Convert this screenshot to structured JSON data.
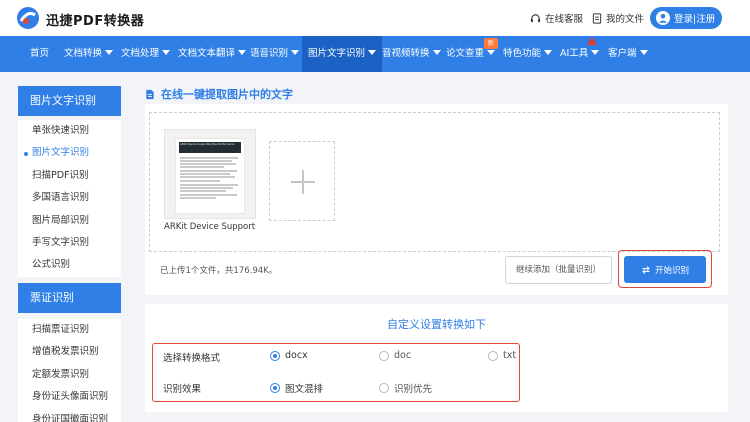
{
  "header": {
    "brand": "迅捷PDF转换器",
    "service": "在线客服",
    "files": "我的文件",
    "login": "登录|注册"
  },
  "nav": {
    "items": [
      {
        "label": "首页"
      },
      {
        "label": "文档转换"
      },
      {
        "label": "文档处理"
      },
      {
        "label": "文档文本翻译"
      },
      {
        "label": "语音识别"
      },
      {
        "label": "图片文字识别"
      },
      {
        "label": "音视频转换"
      },
      {
        "label": "论文查重"
      },
      {
        "label": "特色功能"
      },
      {
        "label": "AI工具"
      },
      {
        "label": "客户端"
      }
    ],
    "hot_badge": "新"
  },
  "sidebar": {
    "group1_title": "图片文字识别",
    "group1_items": [
      "单张快速识别",
      "图片文字识别",
      "扫描PDF识别",
      "多国语言识别",
      "图片局部识别",
      "手写文字识别",
      "公式识别"
    ],
    "group2_title": "票证识别",
    "group2_items": [
      "扫描票证识别",
      "增值税发票识别",
      "定额发票识别",
      "身份证头像面识别",
      "身份证国徽面识别"
    ]
  },
  "main": {
    "title": "在线一键提取图片中的文字",
    "doc_preview_title": "ARKit Device Supporting the Performance",
    "file_name": "ARKit Device Supportin...",
    "status": "已上传1个文件，共176.94K。",
    "continue_button": "继续添加（批量识别）",
    "start_button": "开始识别"
  },
  "settings": {
    "title": "自定义设置转换如下",
    "format_label": "选择转换格式",
    "formats": [
      "docx",
      "doc",
      "txt"
    ],
    "effect_label": "识别效果",
    "effects": [
      "图文混排",
      "识别优先"
    ]
  },
  "colors": {
    "primary": "#2f7fe6",
    "nav_active": "#1c62c4",
    "highlight_frame": "#e0463a",
    "badge": "#ff7a3d"
  }
}
